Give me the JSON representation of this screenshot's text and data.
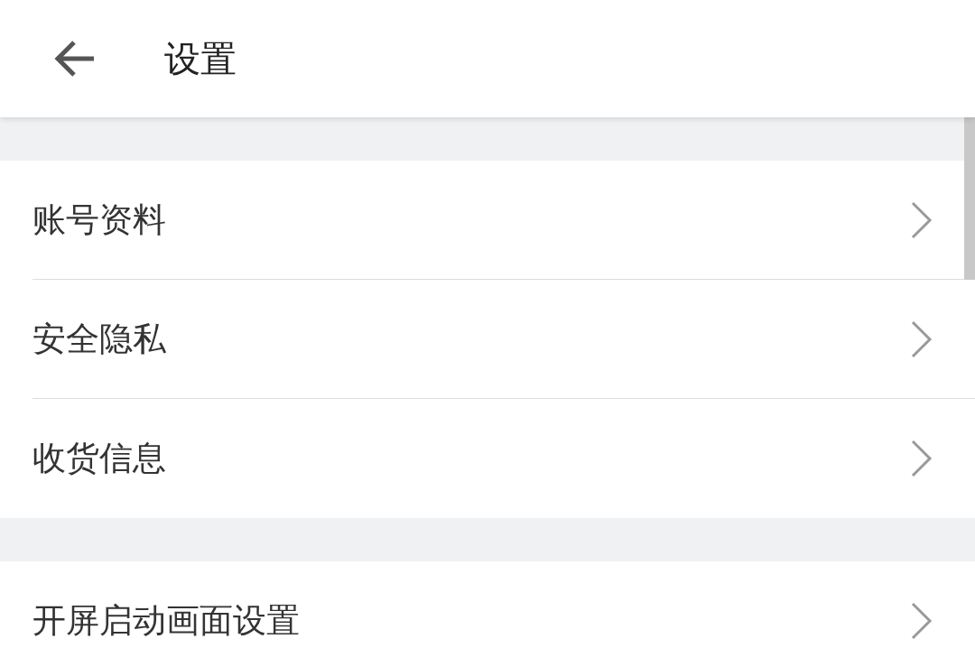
{
  "header": {
    "title": "设置"
  },
  "groups": [
    {
      "items": [
        {
          "label": "账号资料"
        },
        {
          "label": "安全隐私"
        },
        {
          "label": "收货信息"
        }
      ]
    },
    {
      "items": [
        {
          "label": "开屏启动画面设置"
        }
      ]
    }
  ]
}
